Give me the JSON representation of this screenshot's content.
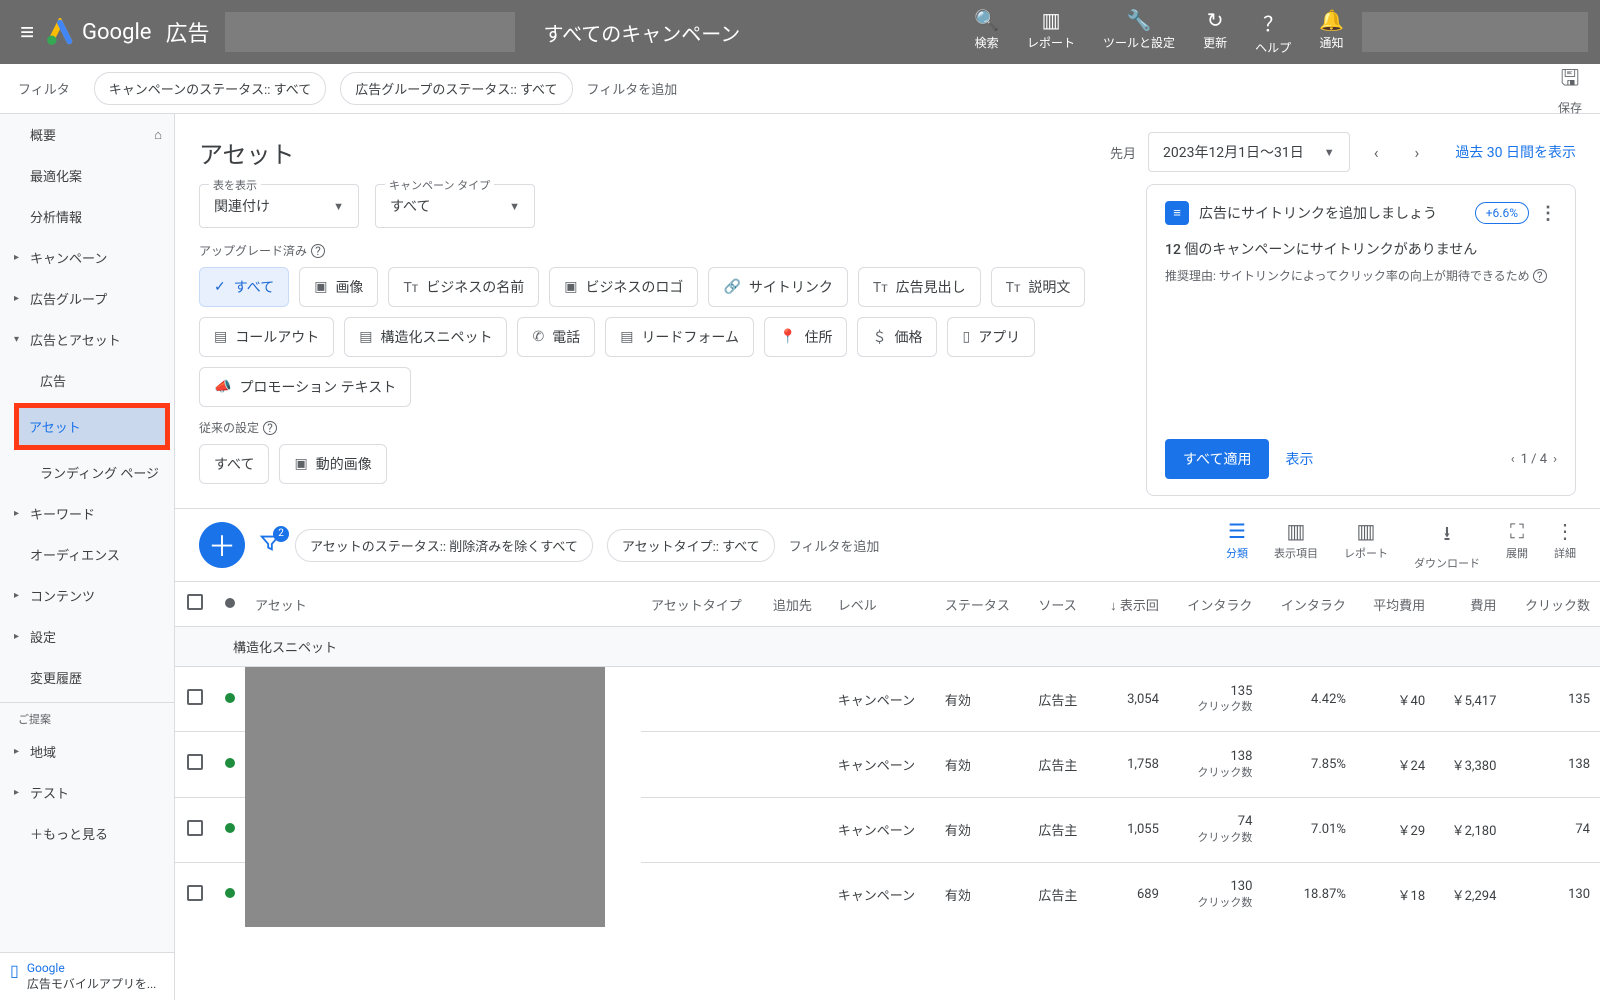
{
  "header": {
    "brand": "Google",
    "product": "広告",
    "scope": "すべてのキャンペーン",
    "tools": {
      "search": "検索",
      "report": "レポート",
      "settings": "ツールと設定",
      "refresh": "更新",
      "help": "ヘルプ",
      "notifications": "通知"
    }
  },
  "filter_bar": {
    "label": "フィルタ",
    "chip1": "キャンペーンのステータス:: すべて",
    "chip2": "広告グループのステータス:: すべて",
    "add": "フィルタを追加",
    "save": "保存"
  },
  "sidebar": {
    "overview": "概要",
    "optimize": "最適化案",
    "insights": "分析情報",
    "campaigns": "キャンペーン",
    "adgroups": "広告グループ",
    "ads_assets": "広告とアセット",
    "ads": "広告",
    "assets": "アセット",
    "landing": "ランディング ページ",
    "keywords": "キーワード",
    "audiences": "オーディエンス",
    "content": "コンテンツ",
    "settings": "設定",
    "history": "変更履歴",
    "suggest_header": "ご提案",
    "regions": "地域",
    "test": "テスト",
    "more": "もっと見る",
    "footer_brand": "Google",
    "footer_text": "広告モバイルアプリを..."
  },
  "page": {
    "title": "アセット",
    "date_label": "先月",
    "date_range": "2023年12月1日～31日",
    "view_30": "過去 30 日間を表示"
  },
  "controls": {
    "show_table_label": "表を表示",
    "show_table_value": "関連付け",
    "camp_type_label": "キャンペーン タイプ",
    "camp_type_value": "すべて",
    "upgraded": "アップグレード済み",
    "legacy": "従来の設定",
    "pills_up": {
      "all": "すべて",
      "image": "画像",
      "bizname": "ビジネスの名前",
      "bizlogo": "ビジネスのロゴ",
      "sitelink": "サイトリンク",
      "headline": "広告見出し",
      "desc": "説明文",
      "callout": "コールアウト",
      "snippet": "構造化スニペット",
      "call": "電話",
      "leadform": "リードフォーム",
      "location": "住所",
      "price": "価格",
      "app": "アプリ",
      "promo": "プロモーション テキスト"
    },
    "pills_legacy": {
      "all": "すべて",
      "dyn_image": "動的画像"
    }
  },
  "reco": {
    "title": "広告にサイトリンクを追加しましょう",
    "badge": "+6.6%",
    "subtitle": "12 個のキャンペーンにサイトリンクがありません",
    "reason": "推奨理由: サイトリンクによってクリック率の向上が期待できるため",
    "apply_all": "すべて適用",
    "view": "表示",
    "pager": "1 / 4"
  },
  "toolbar": {
    "filter_chip1": "アセットのステータス:: 削除済みを除くすべて",
    "filter_chip2": "アセットタイプ:: すべて",
    "add_filter": "フィルタを追加",
    "filter_count": "2",
    "tools": {
      "segment": "分類",
      "columns": "表示項目",
      "report": "レポート",
      "download": "ダウンロード",
      "expand": "展開",
      "more": "詳細"
    }
  },
  "table": {
    "headers": {
      "asset": "アセット",
      "asset_type": "アセットタイプ",
      "added_to": "追加先",
      "level": "レベル",
      "status": "ステータス",
      "source": "ソース",
      "impressions": "表示回",
      "interactions": "インタラク",
      "interaction_rate": "インタラク",
      "avg_cost": "平均費用",
      "cost": "費用",
      "clicks": "クリック数"
    },
    "group_label": "構造化スニペット",
    "click_label": "クリック数",
    "rows": [
      {
        "level": "キャンペーン",
        "status": "有効",
        "source": "広告主",
        "impr": "3,054",
        "inter": "135",
        "rate": "4.42%",
        "avg": "￥40",
        "cost": "￥5,417",
        "clicks": "135"
      },
      {
        "level": "キャンペーン",
        "status": "有効",
        "source": "広告主",
        "impr": "1,758",
        "inter": "138",
        "rate": "7.85%",
        "avg": "￥24",
        "cost": "￥3,380",
        "clicks": "138"
      },
      {
        "level": "キャンペーン",
        "status": "有効",
        "source": "広告主",
        "impr": "1,055",
        "inter": "74",
        "rate": "7.01%",
        "avg": "￥29",
        "cost": "￥2,180",
        "clicks": "74"
      },
      {
        "level": "キャンペーン",
        "status": "有効",
        "source": "広告主",
        "impr": "689",
        "inter": "130",
        "rate": "18.87%",
        "avg": "￥18",
        "cost": "￥2,294",
        "clicks": "130"
      }
    ]
  }
}
